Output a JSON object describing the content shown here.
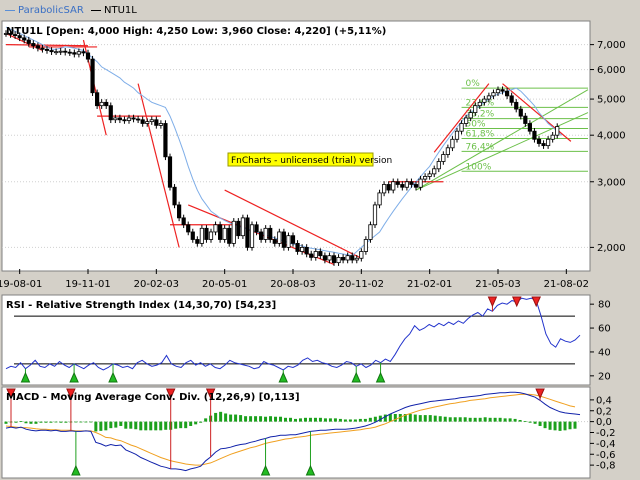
{
  "legend": [
    {
      "label": "ParabolicSAR",
      "color": "#5b8fd6"
    },
    {
      "label": "NTU1L",
      "color": "#000000"
    }
  ],
  "price_info": "NTU1L [Open: 4,000  High: 4,250  Low: 3,960  Close: 4,220] (+5,11%)",
  "watermark": "FnCharts - unlicensed (trial) version",
  "rsi": {
    "title": "RSI - Relative Strength Index (14,30,70) [54,23]",
    "ylim": [
      14,
      86
    ],
    "ticks": [
      "80",
      "60",
      "40",
      "20"
    ],
    "levels": [
      70,
      30
    ],
    "values": [
      26,
      28,
      27,
      31,
      26,
      29,
      33,
      28,
      27,
      30,
      28,
      32,
      29,
      27,
      30,
      28,
      26,
      29,
      31,
      27,
      25,
      27,
      30,
      29,
      27,
      28,
      26,
      31,
      33,
      30,
      28,
      29,
      31,
      37,
      30,
      28,
      27,
      31,
      33,
      29,
      31,
      28,
      30,
      27,
      26,
      29,
      33,
      31,
      30,
      29,
      28,
      26,
      27,
      32,
      30,
      29,
      27,
      25,
      28,
      27,
      29,
      33,
      35,
      32,
      33,
      31,
      30,
      28,
      27,
      29,
      32,
      31,
      28,
      30,
      27,
      29,
      33,
      31,
      34,
      32,
      38,
      45,
      51,
      55,
      62,
      58,
      60,
      63,
      61,
      64,
      62,
      65,
      63,
      66,
      64,
      68,
      71,
      73,
      70,
      76,
      74,
      79,
      81,
      80,
      83,
      82,
      85,
      84,
      85,
      83,
      70,
      55,
      47,
      44,
      51,
      49,
      48,
      50,
      54
    ],
    "buy_signal_idx": [
      4,
      14,
      22,
      57,
      72,
      77
    ],
    "sell_signal_idx": [
      100,
      105,
      109
    ]
  },
  "macd": {
    "title": "MACD - Moving Average Conv. Div. (12,26,9) [0,113]",
    "ylim": [
      -1.0,
      0.6
    ],
    "ticks": [
      "0,4",
      "0,2",
      "0,0",
      "-0,2",
      "-0,4",
      "-0,6",
      "-0,8"
    ],
    "macd": [
      -0.12,
      -0.1,
      -0.12,
      -0.1,
      -0.14,
      -0.16,
      -0.17,
      -0.16,
      -0.16,
      -0.17,
      -0.16,
      -0.18,
      -0.18,
      -0.17,
      -0.18,
      -0.18,
      -0.17,
      -0.18,
      -0.38,
      -0.41,
      -0.45,
      -0.42,
      -0.44,
      -0.43,
      -0.52,
      -0.56,
      -0.6,
      -0.66,
      -0.7,
      -0.74,
      -0.78,
      -0.82,
      -0.84,
      -0.87,
      -0.87,
      -0.88,
      -0.9,
      -0.87,
      -0.85,
      -0.82,
      -0.72,
      -0.65,
      -0.56,
      -0.5,
      -0.49,
      -0.47,
      -0.44,
      -0.42,
      -0.41,
      -0.38,
      -0.36,
      -0.33,
      -0.31,
      -0.28,
      -0.27,
      -0.25,
      -0.25,
      -0.24,
      -0.24,
      -0.22,
      -0.2,
      -0.18,
      -0.17,
      -0.16,
      -0.16,
      -0.15,
      -0.14,
      -0.14,
      -0.14,
      -0.13,
      -0.12,
      -0.1,
      -0.08,
      -0.05,
      -0.01,
      0.04,
      0.09,
      0.14,
      0.18,
      0.22,
      0.26,
      0.29,
      0.31,
      0.33,
      0.35,
      0.37,
      0.38,
      0.39,
      0.4,
      0.41,
      0.42,
      0.44,
      0.45,
      0.46,
      0.47,
      0.48,
      0.5,
      0.51,
      0.52,
      0.53,
      0.53,
      0.54,
      0.54,
      0.53,
      0.51,
      0.48,
      0.45,
      0.39,
      0.32,
      0.26,
      0.22,
      0.18,
      0.16,
      0.15,
      0.14,
      0.13
    ],
    "signal": [
      -0.08,
      -0.09,
      -0.1,
      -0.11,
      -0.11,
      -0.12,
      -0.13,
      -0.14,
      -0.14,
      -0.15,
      -0.15,
      -0.16,
      -0.16,
      -0.16,
      -0.17,
      -0.17,
      -0.17,
      -0.17,
      -0.2,
      -0.24,
      -0.29,
      -0.3,
      -0.33,
      -0.35,
      -0.39,
      -0.43,
      -0.46,
      -0.5,
      -0.54,
      -0.58,
      -0.62,
      -0.66,
      -0.69,
      -0.72,
      -0.74,
      -0.76,
      -0.78,
      -0.79,
      -0.8,
      -0.8,
      -0.78,
      -0.76,
      -0.72,
      -0.68,
      -0.64,
      -0.6,
      -0.57,
      -0.54,
      -0.51,
      -0.48,
      -0.46,
      -0.43,
      -0.4,
      -0.38,
      -0.36,
      -0.34,
      -0.32,
      -0.31,
      -0.29,
      -0.28,
      -0.27,
      -0.25,
      -0.24,
      -0.23,
      -0.22,
      -0.21,
      -0.2,
      -0.19,
      -0.18,
      -0.17,
      -0.16,
      -0.15,
      -0.13,
      -0.12,
      -0.1,
      -0.07,
      -0.04,
      0.0,
      0.04,
      0.08,
      0.12,
      0.15,
      0.18,
      0.21,
      0.23,
      0.25,
      0.27,
      0.29,
      0.31,
      0.33,
      0.34,
      0.36,
      0.37,
      0.39,
      0.4,
      0.41,
      0.42,
      0.44,
      0.45,
      0.46,
      0.47,
      0.48,
      0.49,
      0.5,
      0.5,
      0.5,
      0.49,
      0.47,
      0.44,
      0.41,
      0.38,
      0.35,
      0.32,
      0.29,
      0.27
    ],
    "buy_signal_idx": [
      14,
      52,
      61
    ],
    "sell_signal_idx": [
      1,
      13,
      33,
      41,
      107
    ]
  },
  "chart_data": {
    "type": "candlestick",
    "title": "NTU1L",
    "x_tick_labels": [
      "19-08-01",
      "19-11-01",
      "20-02-03",
      "20-05-01",
      "20-08-03",
      "20-11-02",
      "21-02-01",
      "21-05-03",
      "21-08-02"
    ],
    "x_tick_idx": [
      3,
      18,
      33,
      48,
      63,
      78,
      93,
      108,
      123
    ],
    "bar_count": 127,
    "ylim": [
      1.75,
      8.0
    ],
    "y_scale": "log",
    "y_ticks": [
      2.0,
      3.0,
      4.0,
      5.0,
      6.0,
      7.0
    ],
    "y_tick_labels": [
      "2,000",
      "3,000",
      "4,000",
      "5,000",
      "6,000",
      "7,000"
    ],
    "close": [
      7.5,
      7.45,
      7.4,
      7.3,
      7.2,
      7.05,
      6.95,
      6.85,
      6.8,
      6.75,
      6.7,
      6.7,
      6.72,
      6.68,
      6.66,
      6.6,
      6.7,
      6.65,
      6.4,
      5.2,
      4.8,
      4.9,
      4.8,
      4.4,
      4.45,
      4.4,
      4.38,
      4.45,
      4.42,
      4.4,
      4.3,
      4.35,
      4.4,
      4.25,
      4.3,
      3.5,
      2.9,
      2.6,
      2.4,
      2.3,
      2.2,
      2.1,
      2.05,
      2.25,
      2.1,
      2.2,
      2.3,
      2.1,
      2.25,
      2.05,
      2.35,
      2.15,
      2.4,
      2.0,
      2.3,
      2.2,
      2.1,
      2.25,
      2.1,
      2.05,
      2.2,
      2.0,
      2.15,
      2.05,
      1.95,
      2.0,
      1.92,
      1.88,
      1.95,
      1.9,
      1.85,
      1.9,
      1.82,
      1.88,
      1.85,
      1.9,
      1.85,
      1.87,
      1.95,
      2.1,
      2.3,
      2.6,
      2.8,
      2.95,
      2.85,
      3.0,
      2.95,
      2.9,
      3.0,
      2.95,
      2.9,
      3.05,
      3.1,
      3.15,
      3.25,
      3.4,
      3.55,
      3.7,
      3.9,
      4.1,
      4.3,
      4.45,
      4.6,
      4.8,
      4.9,
      5.0,
      5.1,
      5.2,
      5.3,
      5.25,
      5.1,
      4.9,
      4.7,
      4.5,
      4.3,
      4.1,
      3.9,
      3.8,
      3.75,
      3.9,
      4.0,
      4.22
    ],
    "sar": [
      7.8,
      7.7,
      7.6,
      7.5,
      7.4,
      7.3,
      7.2,
      7.1,
      7.0,
      6.9,
      6.8,
      6.8,
      6.85,
      6.9,
      6.88,
      6.85,
      6.8,
      6.75,
      6.6,
      6.45,
      6.3,
      6.1,
      6.0,
      5.9,
      5.8,
      5.7,
      5.55,
      5.45,
      5.35,
      5.2,
      5.1,
      5.0,
      4.9,
      4.85,
      4.8,
      4.75,
      4.5,
      4.2,
      3.9,
      3.6,
      3.3,
      3.05,
      2.85,
      2.7,
      2.6,
      2.5,
      2.45,
      2.4,
      2.36,
      2.33,
      2.3,
      2.28,
      2.26,
      2.24,
      2.22,
      2.2,
      2.18,
      2.16,
      2.14,
      2.12,
      2.1,
      2.08,
      2.06,
      2.04,
      2.03,
      2.02,
      2.0,
      1.99,
      1.98,
      1.97,
      1.96,
      1.95,
      1.94,
      1.93,
      1.92,
      1.91,
      1.9,
      1.95,
      2.0,
      2.05,
      2.1,
      2.15,
      2.2,
      2.3,
      2.4,
      2.5,
      2.6,
      2.7,
      2.8,
      2.9,
      3.0,
      3.1,
      3.2,
      3.3,
      3.45,
      3.6,
      3.75,
      3.9,
      4.05,
      4.2,
      4.35,
      4.5,
      4.6,
      4.7,
      4.8,
      4.9,
      5.0,
      5.1,
      5.15,
      5.2,
      5.25,
      5.3,
      5.35,
      5.25,
      5.1,
      4.95,
      4.8,
      4.6,
      4.45,
      4.3,
      4.2,
      4.1,
      4.0
    ],
    "fibonacci": {
      "labels": [
        "0%",
        "23,6%",
        "38,2%",
        "50%",
        "61,8%",
        "76,4%",
        "100%"
      ],
      "values": [
        5.35,
        4.75,
        4.43,
        4.17,
        3.92,
        3.62,
        3.2
      ],
      "color": "#6cc04a"
    },
    "colors": {
      "up": "#ffffff",
      "down": "#000000",
      "trendline": "#ee2222",
      "sar": "#7faee8",
      "grid": "#000000"
    }
  }
}
